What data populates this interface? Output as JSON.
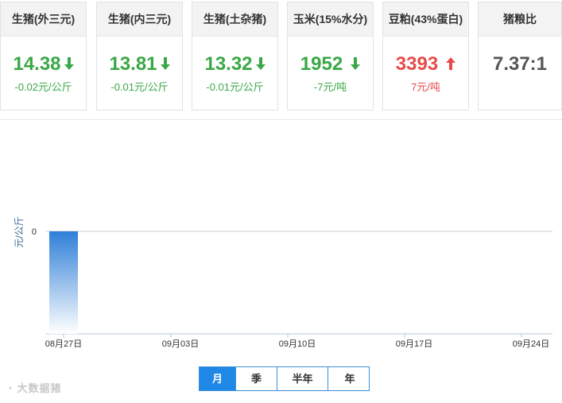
{
  "cards": [
    {
      "title": "生猪(外三元)",
      "value": "14.38",
      "change": "-0.02元/公斤",
      "trend": "down"
    },
    {
      "title": "生猪(内三元)",
      "value": "13.81",
      "change": "-0.01元/公斤",
      "trend": "down"
    },
    {
      "title": "生猪(土杂猪)",
      "value": "13.32",
      "change": "-0.01元/公斤",
      "trend": "down"
    },
    {
      "title": "玉米(15%水分)",
      "value": "1952",
      "change": "-7元/吨",
      "trend": "down"
    },
    {
      "title": "豆粕(43%蛋白)",
      "value": "3393",
      "change": "7元/吨",
      "trend": "up"
    },
    {
      "title": "猪粮比",
      "value": "7.37:1",
      "change": "",
      "trend": "none"
    }
  ],
  "colors": {
    "down": "#3aa846",
    "up": "#e84b4b",
    "bar": "#2f7fd8",
    "active_tab": "#1f87e5"
  },
  "chart_data": {
    "type": "bar",
    "ylabel": "元/公斤",
    "x_ticks": [
      "08月27日",
      "09月03日",
      "09月10日",
      "09月17日",
      "09月24日"
    ],
    "categories": [
      "08月27日"
    ],
    "values": [
      0
    ],
    "y_ticks": [
      "0"
    ],
    "grid": false
  },
  "period_tabs": [
    {
      "label": "月",
      "active": true
    },
    {
      "label": "季",
      "active": false
    },
    {
      "label": "半年",
      "active": false
    },
    {
      "label": "年",
      "active": false
    }
  ],
  "watermark": "大数据猪"
}
